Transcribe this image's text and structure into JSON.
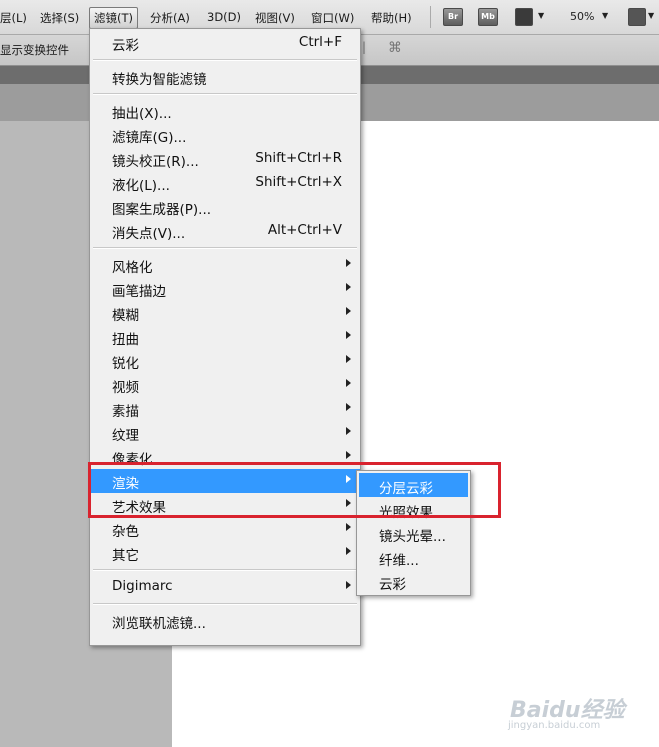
{
  "menubar": {
    "items": [
      "层(L)",
      "选择(S)",
      "滤镜(T)",
      "分析(A)",
      "3D(D)",
      "视图(V)",
      "窗口(W)",
      "帮助(H)"
    ],
    "active_index": 2,
    "br_label": "Br",
    "mb_label": "Mb",
    "zoom": "50%"
  },
  "options_bar": {
    "show_transform_controls": "显示变换控件"
  },
  "filter_menu": {
    "sections": [
      [
        {
          "label": "云彩",
          "shortcut": "Ctrl+F"
        }
      ],
      [
        {
          "label": "转换为智能滤镜"
        }
      ],
      [
        {
          "label": "抽出(X)..."
        },
        {
          "label": "滤镜库(G)..."
        },
        {
          "label": "镜头校正(R)...",
          "shortcut": "Shift+Ctrl+R"
        },
        {
          "label": "液化(L)...",
          "shortcut": "Shift+Ctrl+X"
        },
        {
          "label": "图案生成器(P)..."
        },
        {
          "label": "消失点(V)...",
          "shortcut": "Alt+Ctrl+V"
        }
      ],
      [
        {
          "label": "风格化",
          "submenu": true
        },
        {
          "label": "画笔描边",
          "submenu": true
        },
        {
          "label": "模糊",
          "submenu": true
        },
        {
          "label": "扭曲",
          "submenu": true
        },
        {
          "label": "锐化",
          "submenu": true
        },
        {
          "label": "视频",
          "submenu": true
        },
        {
          "label": "素描",
          "submenu": true
        },
        {
          "label": "纹理",
          "submenu": true
        },
        {
          "label": "像素化",
          "submenu": true
        },
        {
          "label": "渲染",
          "submenu": true,
          "highlighted": true
        },
        {
          "label": "艺术效果",
          "submenu": true
        },
        {
          "label": "杂色",
          "submenu": true
        },
        {
          "label": "其它",
          "submenu": true
        }
      ],
      [
        {
          "label": "Digimarc",
          "submenu": true
        }
      ],
      [
        {
          "label": "浏览联机滤镜..."
        }
      ]
    ]
  },
  "render_submenu": {
    "items": [
      {
        "label": "分层云彩",
        "highlighted": true
      },
      {
        "label": "光照效果..."
      },
      {
        "label": "镜头光晕..."
      },
      {
        "label": "纤维..."
      },
      {
        "label": "云彩"
      }
    ]
  },
  "watermark": {
    "brand": "Baidu经验",
    "url": "jingyan.baidu.com"
  },
  "colors": {
    "highlight": "#3399ff",
    "annotation_red": "#d9232e",
    "menu_bg": "#f0f0f0"
  }
}
